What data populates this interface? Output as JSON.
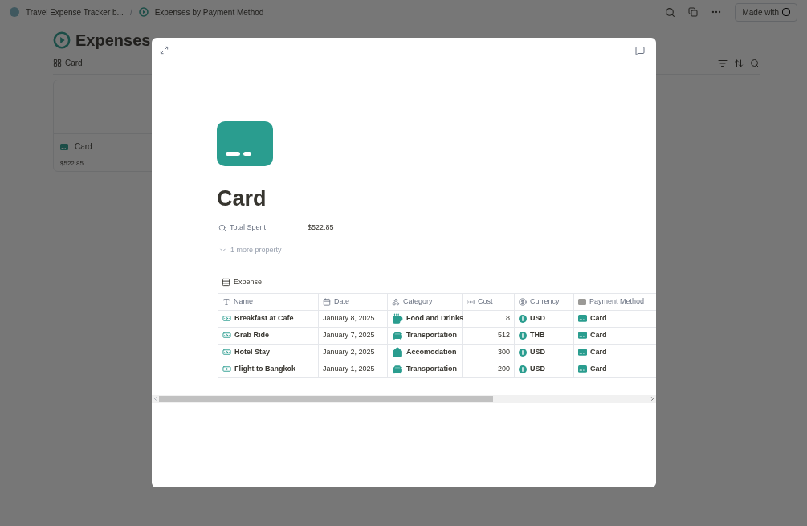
{
  "breadcrumbs": [
    {
      "label": "Travel Expense Tracker b..."
    },
    {
      "label": "Expenses by Payment Method"
    }
  ],
  "breadcrumb_separator": "/",
  "made_with": "Made with",
  "page": {
    "title": "Expenses",
    "view_tab": "Card",
    "gallery_card": {
      "title": "Card",
      "value": "$522.85"
    }
  },
  "modal": {
    "title": "Card",
    "properties": [
      {
        "label": "Total Spent",
        "value": "$522.85"
      }
    ],
    "more": "1 more property",
    "table": {
      "title": "Expense",
      "columns": [
        "Name",
        "Date",
        "Category",
        "Cost",
        "Currency",
        "Payment Method"
      ],
      "rows": [
        {
          "name": "Breakfast at Cafe",
          "date": "January 8, 2025",
          "category": {
            "label": "Food and Drinks",
            "kind": "food"
          },
          "cost": "8",
          "currency": "USD",
          "payment": "Card"
        },
        {
          "name": "Grab Ride",
          "date": "January 7, 2025",
          "category": {
            "label": "Transportation",
            "kind": "transport"
          },
          "cost": "512",
          "currency": "THB",
          "payment": "Card"
        },
        {
          "name": "Hotel Stay",
          "date": "January 2, 2025",
          "category": {
            "label": "Accomodation",
            "kind": "lodging"
          },
          "cost": "300",
          "currency": "USD",
          "payment": "Card"
        },
        {
          "name": "Flight to Bangkok",
          "date": "January 1, 2025",
          "category": {
            "label": "Transportation",
            "kind": "transport"
          },
          "cost": "200",
          "currency": "USD",
          "payment": "Card"
        }
      ]
    }
  }
}
